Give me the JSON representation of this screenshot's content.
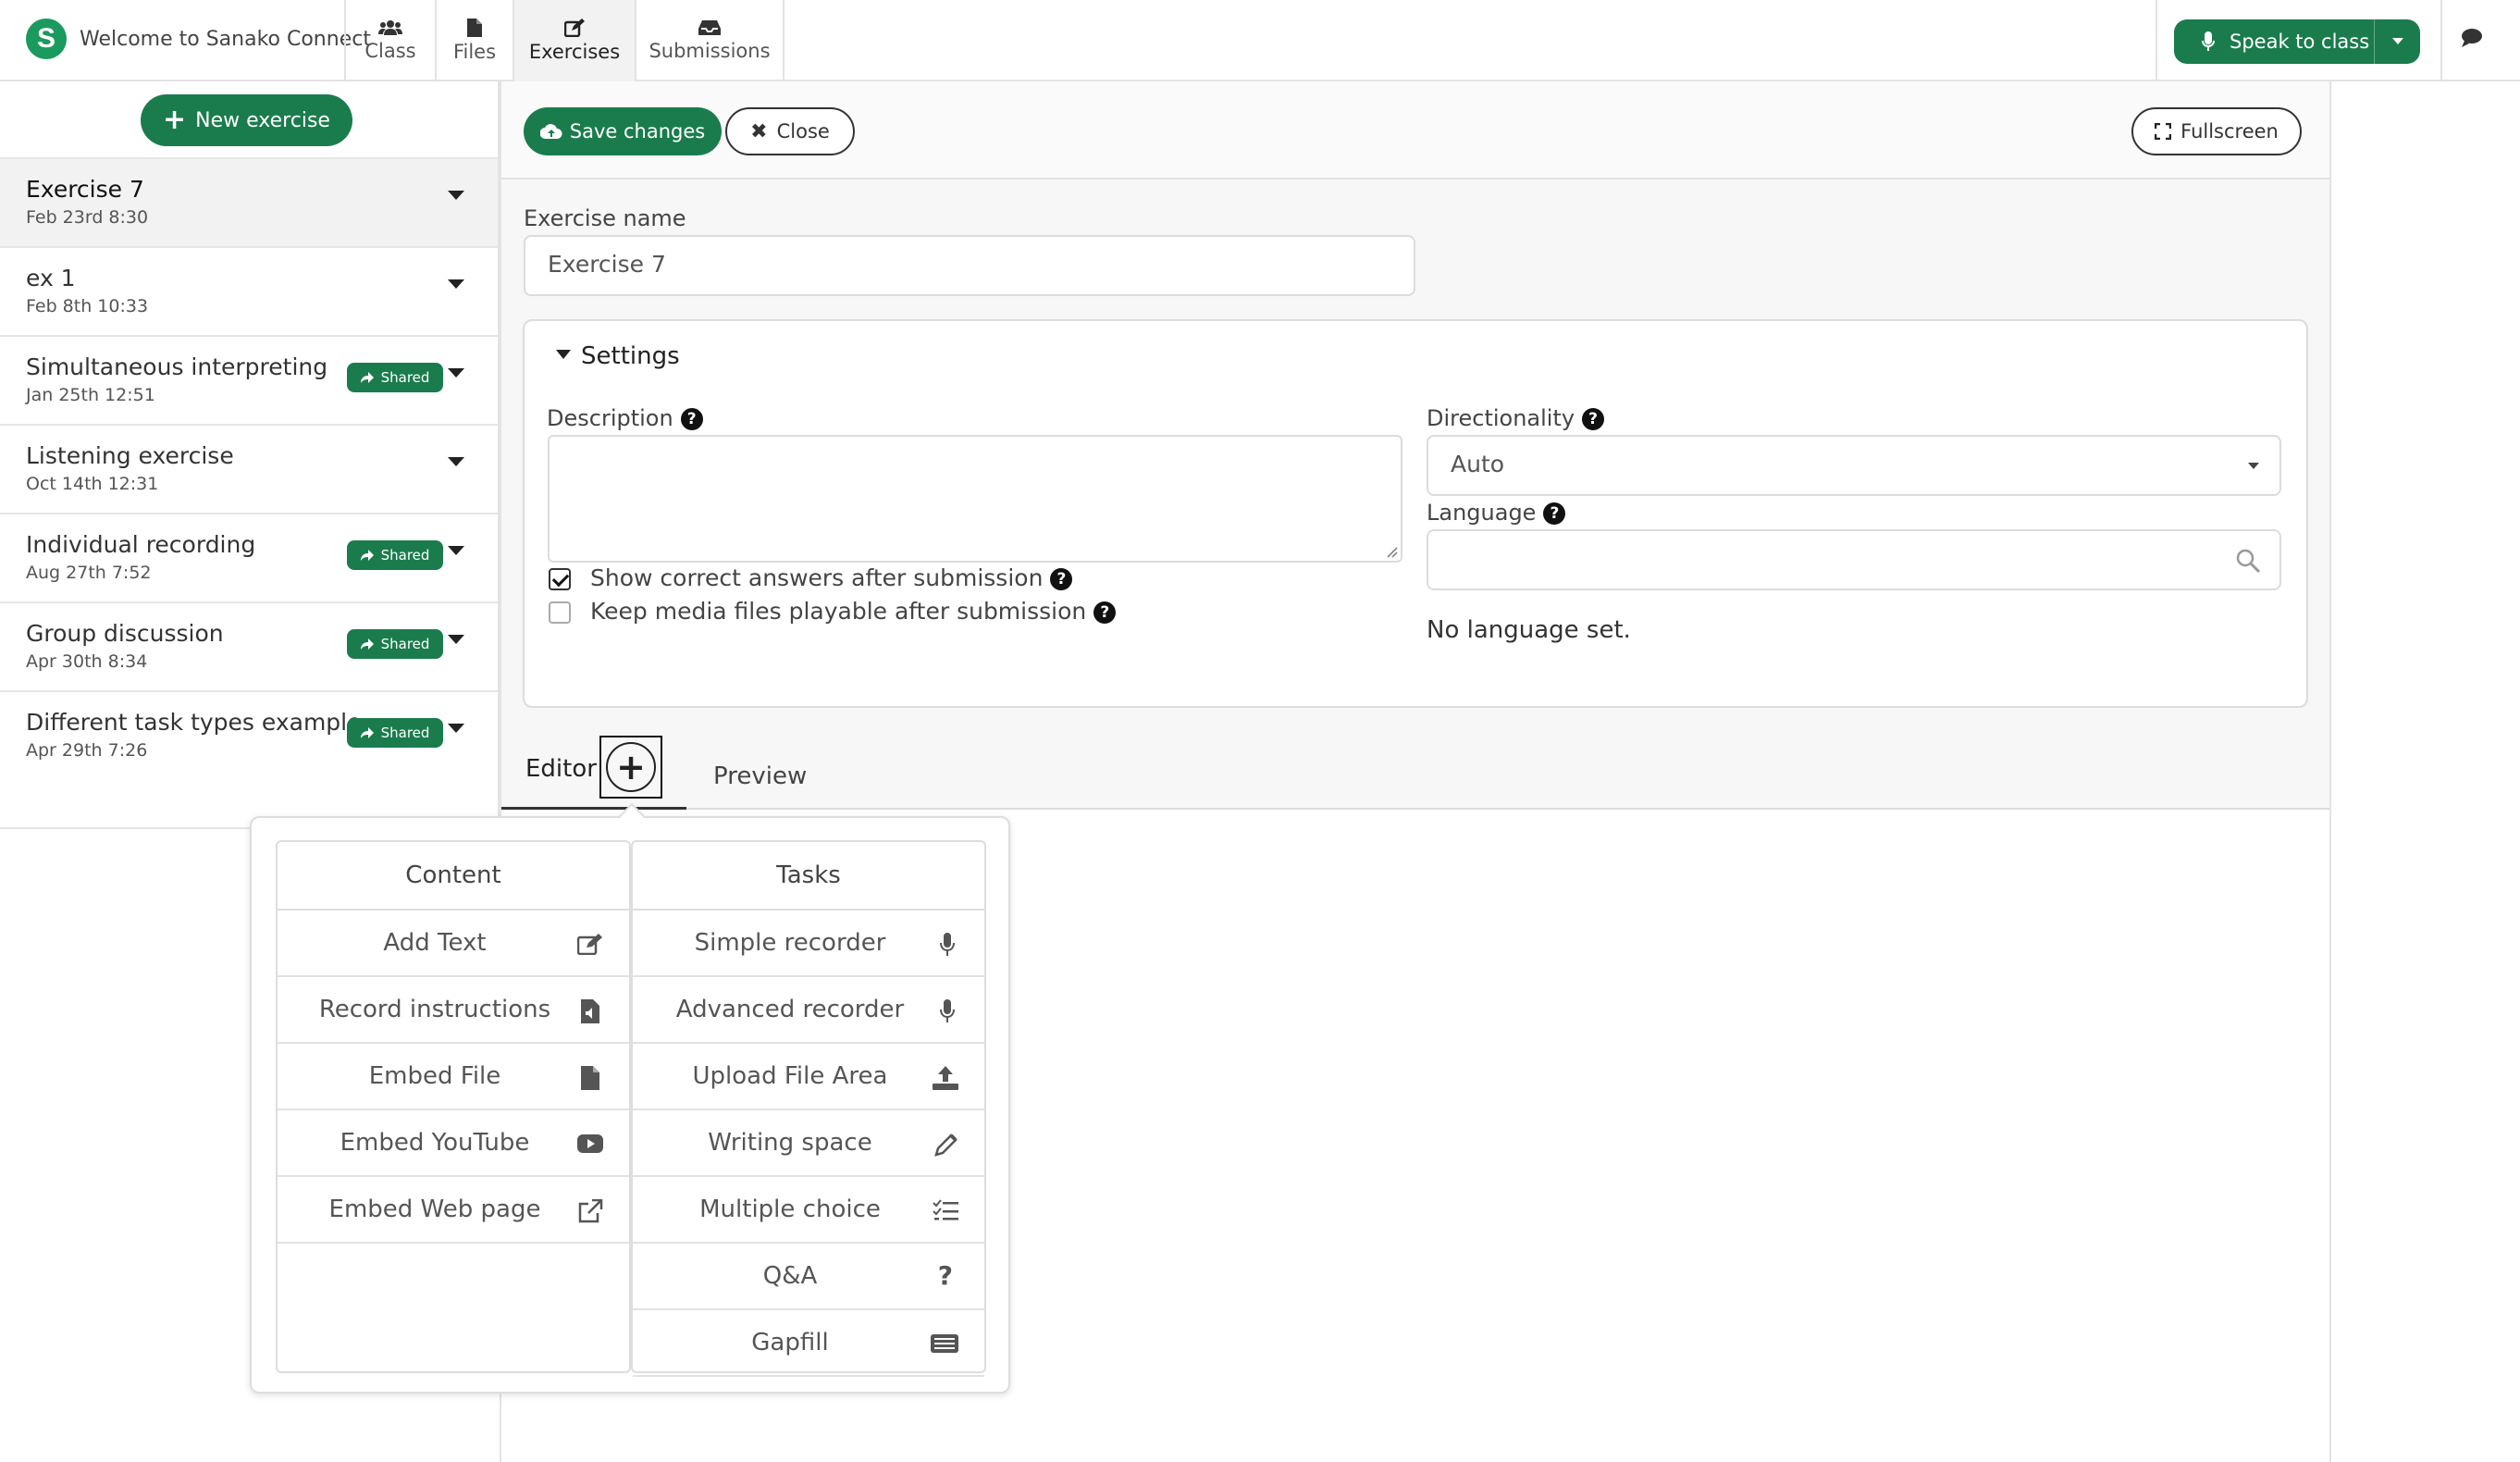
{
  "topbar": {
    "logo_letter": "S",
    "app_title": "Welcome to Sanako Connect",
    "tabs": [
      {
        "label": "Class",
        "icon": "users-icon"
      },
      {
        "label": "Files",
        "icon": "file-icon"
      },
      {
        "label": "Exercises",
        "icon": "edit-icon",
        "active": true
      },
      {
        "label": "Submissions",
        "icon": "inbox-icon"
      }
    ],
    "speak_label": "Speak to class",
    "chat_icon": "chat-icon"
  },
  "sidebar": {
    "new_exercise_label": "New exercise",
    "items": [
      {
        "name": "Exercise 7",
        "date": "Feb 23rd 8:30",
        "shared": false
      },
      {
        "name": "ex 1",
        "date": "Feb 8th 10:33",
        "shared": false
      },
      {
        "name": "Simultaneous interpreting",
        "date": "Jan 25th 12:51",
        "shared": true
      },
      {
        "name": "Listening exercise",
        "date": "Oct 14th 12:31",
        "shared": false
      },
      {
        "name": "Individual recording",
        "date": "Aug 27th 7:52",
        "shared": true
      },
      {
        "name": "Group discussion",
        "date": "Apr 30th 8:34",
        "shared": true
      },
      {
        "name": "Different task types example",
        "date": "Apr 29th 7:26",
        "shared": true
      }
    ],
    "shared_label": "Shared"
  },
  "toolbar": {
    "save_label": "Save changes",
    "close_label": "Close",
    "fullscreen_label": "Fullscreen"
  },
  "form": {
    "exercise_name_label": "Exercise name",
    "exercise_name_value": "Exercise 7",
    "settings_label": "Settings",
    "description_label": "Description",
    "description_value": "",
    "show_answers_label": "Show correct answers after submission",
    "show_answers_checked": true,
    "keep_media_label": "Keep media files playable after submission",
    "keep_media_checked": false,
    "directionality_label": "Directionality",
    "directionality_value": "Auto",
    "language_label": "Language",
    "language_value": "",
    "no_language_text": "No language set."
  },
  "editor": {
    "tab_editor": "Editor",
    "tab_preview": "Preview"
  },
  "popup": {
    "content_header": "Content",
    "tasks_header": "Tasks",
    "content_items": [
      {
        "label": "Add Text",
        "icon": "edit-icon"
      },
      {
        "label": "Record instructions",
        "icon": "audio-file-icon"
      },
      {
        "label": "Embed File",
        "icon": "file-icon"
      },
      {
        "label": "Embed YouTube",
        "icon": "youtube-icon"
      },
      {
        "label": "Embed Web page",
        "icon": "external-link-icon"
      }
    ],
    "task_items": [
      {
        "label": "Simple recorder",
        "icon": "microphone-icon"
      },
      {
        "label": "Advanced recorder",
        "icon": "microphone-icon"
      },
      {
        "label": "Upload File Area",
        "icon": "upload-icon"
      },
      {
        "label": "Writing space",
        "icon": "pencil-icon"
      },
      {
        "label": "Multiple choice",
        "icon": "checklist-icon"
      },
      {
        "label": "Q&A",
        "icon": "question-icon"
      },
      {
        "label": "Gapfill",
        "icon": "keyboard-icon"
      }
    ]
  },
  "colors": {
    "brand_green": "#1a7c4d",
    "logo_green": "#1b9a5f"
  }
}
